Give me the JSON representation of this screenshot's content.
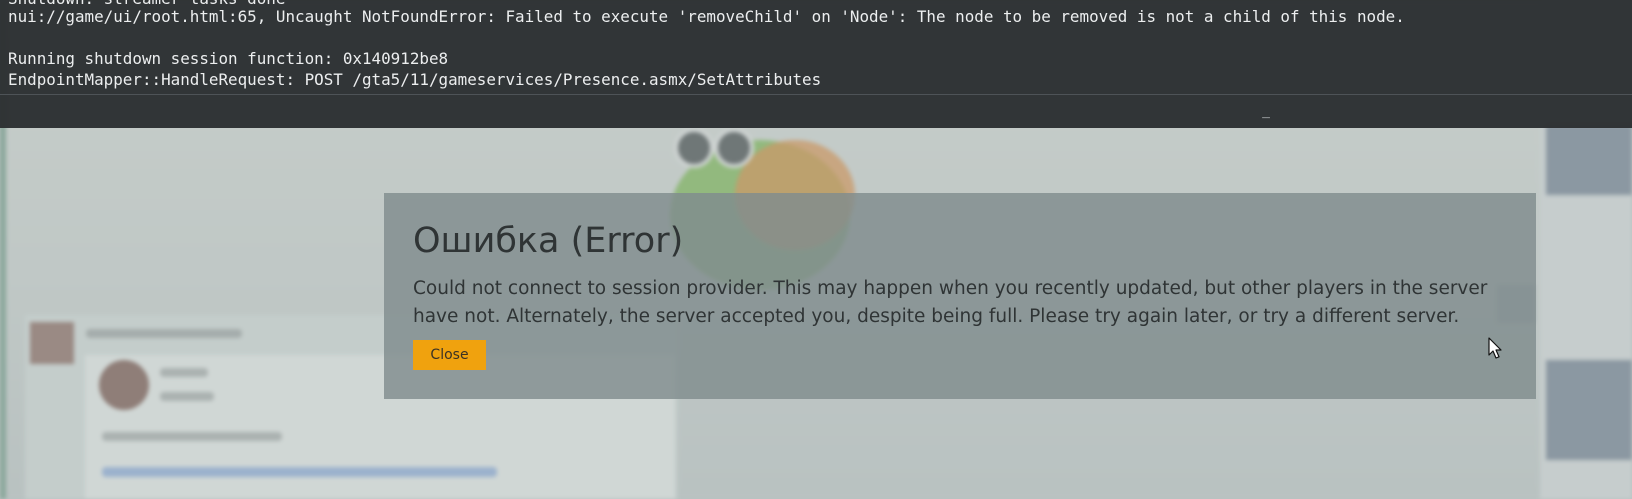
{
  "console": {
    "lines": [
      "Shutdown: streamer tasks done",
      "nui://game/ui/root.html:65, Uncaught NotFoundError: Failed to execute 'removeChild' on 'Node': The node to be removed is not a child of this node.",
      "",
      "Running shutdown session function: 0x140912be8",
      "EndpointMapper::HandleRequest: POST /gta5/11/gameservices/Presence.asmx/SetAttributes"
    ],
    "minimize_label": "_"
  },
  "dialog": {
    "title": "Ошибка (Error)",
    "message": "Could not connect to session provider. This may happen when you recently updated, but other players in the server have not. Alternately, the server accepted you, despite being full. Please try again later, or try a different server.",
    "close_label": "Close",
    "accent_color": "#f0a20e"
  },
  "cursor": {
    "icon": "arrow-cursor-icon"
  }
}
